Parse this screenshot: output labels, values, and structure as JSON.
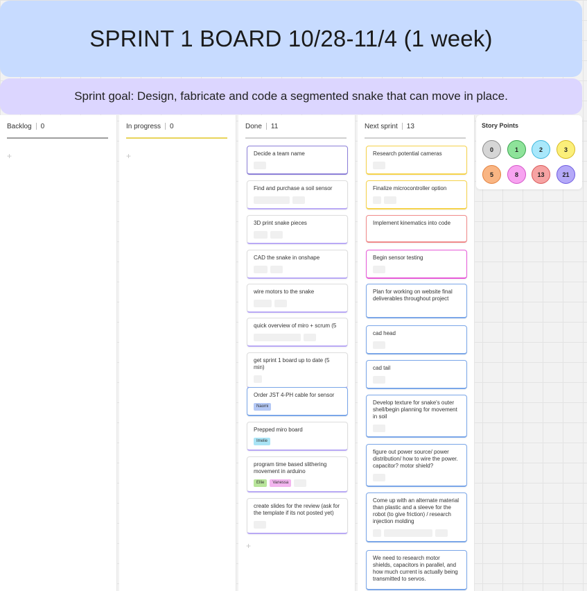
{
  "title": "SPRINT 1 BOARD 10/28-11/4 (1 week)",
  "goal": "Sprint goal: Design, fabricate and code a segmented snake that can move in place.",
  "columns": [
    {
      "name": "Backlog",
      "count": "0",
      "line_color": "#9e9e9e"
    },
    {
      "name": "In progress",
      "count": "0",
      "line_color": "#e8d45a"
    },
    {
      "name": "Done",
      "count": "11",
      "line_color": "#d0d0d0"
    },
    {
      "name": "Next sprint",
      "count": "13",
      "line_color": "#d0d0d0"
    }
  ],
  "add_symbol": "+",
  "done_cards": [
    {
      "text": "Decide a team name",
      "color": "#8c7fd8"
    },
    {
      "text": "Find and purchase a soil sensor",
      "color": "#b9a9f5"
    },
    {
      "text": "3D print snake pieces",
      "color": "#b9a9f5"
    },
    {
      "text": "CAD the snake in onshape",
      "color": "#b9a9f5"
    },
    {
      "text": "wire motors to the snake",
      "color": "#b9a9f5"
    },
    {
      "text": "quick overview of miro + scrum (5",
      "color": "#b9a9f5"
    },
    {
      "text": "get sprint 1 board up to date (5 min)",
      "color": "#b9a9f5"
    },
    {
      "text": "Order JST 4-PH cable for sensor",
      "color": "#7aa6e8",
      "tags": [
        {
          "label": "Naomi",
          "color": "#b4c8f5"
        }
      ]
    },
    {
      "text": "Prepped miro board",
      "color": "#b9a9f5",
      "tags": [
        {
          "label": "Imelie",
          "color": "#a9e4f5"
        }
      ]
    },
    {
      "text": "program time based slithering movement in arduino",
      "color": "#b9a9f5",
      "tags": [
        {
          "label": "Ellie",
          "color": "#b8e59a"
        },
        {
          "label": "Vanessa",
          "color": "#f3b5ef"
        }
      ]
    },
    {
      "text": "create slides for the review (ask for the template if its not posted yet)",
      "color": "#b9a9f5"
    }
  ],
  "next_cards": [
    {
      "text": "Research potential cameras",
      "color": "#f5d24a"
    },
    {
      "text": "Finalize microcontroller option",
      "color": "#f5d24a"
    },
    {
      "text": "Implement kinematics into code",
      "color": "#f08a8a"
    },
    {
      "text": "Begin sensor testing",
      "color": "#e65ad8"
    },
    {
      "text": "Plan for working on website final deliverables throughout project",
      "color": "#7aa6e8"
    },
    {
      "text": "cad head",
      "color": "#7aa6e8"
    },
    {
      "text": "cad tail",
      "color": "#7aa6e8"
    },
    {
      "text": "Develop texture for snake's outer shell/begin planning for movement in soil",
      "color": "#7aa6e8"
    },
    {
      "text": "figure out power source/ power distribution/ how to wire the power. capacitor? motor shield?",
      "color": "#7aa6e8"
    },
    {
      "text": "Come up with an alternate material than plastic and a sleeve for the robot (to give friction) / research injection molding",
      "color": "#7aa6e8"
    },
    {
      "text": "We need to research motor shields, capacitors in parallel, and how much current is actually being transmitted to servos.",
      "color": "#7aa6e8"
    }
  ],
  "story_points": {
    "title": "Story Points",
    "values": [
      {
        "label": "0",
        "fill": "#d6d6d6",
        "border": "#8a8a8a"
      },
      {
        "label": "1",
        "fill": "#8ee39a",
        "border": "#3aa24e"
      },
      {
        "label": "2",
        "fill": "#a9e8fb",
        "border": "#3cb6dd"
      },
      {
        "label": "3",
        "fill": "#fbef7a",
        "border": "#d6b81e"
      },
      {
        "label": "5",
        "fill": "#f9b583",
        "border": "#e3803d"
      },
      {
        "label": "8",
        "fill": "#f7a3f0",
        "border": "#d455c8"
      },
      {
        "label": "13",
        "fill": "#f6a3a3",
        "border": "#d95757"
      },
      {
        "label": "21",
        "fill": "#b4a9f8",
        "border": "#6e5be0"
      }
    ]
  }
}
